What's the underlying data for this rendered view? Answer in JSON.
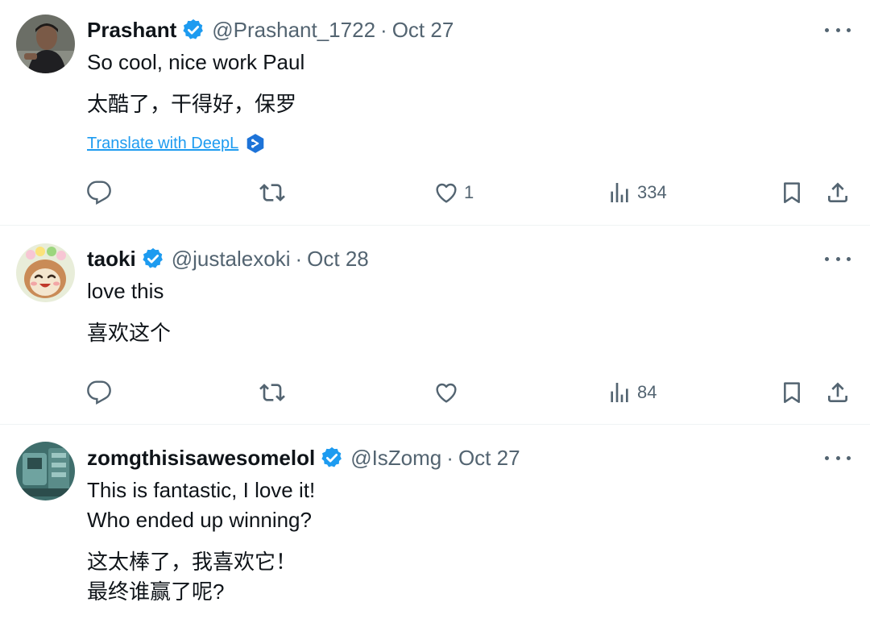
{
  "colors": {
    "accent": "#1d9bf0",
    "muted": "#536471",
    "text": "#0f1419",
    "divider": "#eff3f4"
  },
  "tweets": [
    {
      "name": "Prashant",
      "handle": "@Prashant_1722",
      "separator": "·",
      "date": "Oct 27",
      "lines": [
        "So cool, nice work Paul"
      ],
      "translation": [
        "太酷了，干得好，保罗"
      ],
      "translate_link": "Translate with DeepL",
      "replies": "",
      "retweets": "",
      "likes": "1",
      "views": "334",
      "avatar_icon": "person-photo"
    },
    {
      "name": "taoki",
      "handle": "@justalexoki",
      "separator": "·",
      "date": "Oct 28",
      "lines": [
        "love this"
      ],
      "translation": [
        "喜欢这个"
      ],
      "replies": "",
      "retweets": "",
      "likes": "",
      "views": "84",
      "avatar_icon": "cartoon-creature"
    },
    {
      "name": "zomgthisisawesomelol",
      "handle": "@IsZomg",
      "separator": "·",
      "date": "Oct 27",
      "lines": [
        "This is fantastic, I love it!",
        "Who ended up winning?"
      ],
      "translation": [
        "这太棒了，我喜欢它！",
        "最终谁赢了呢?"
      ],
      "avatar_icon": "teal-photo"
    }
  ]
}
